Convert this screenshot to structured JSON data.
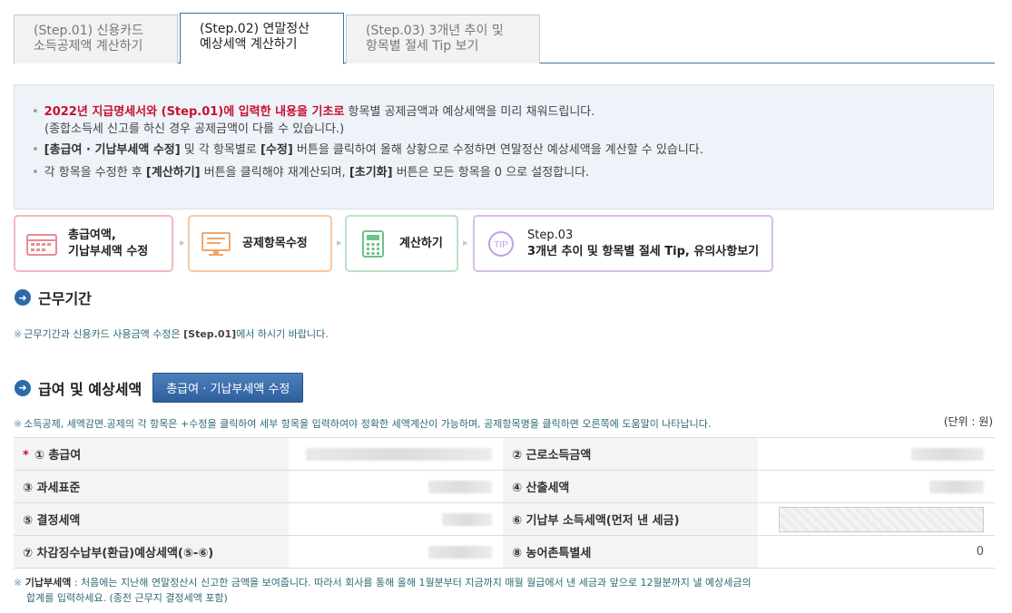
{
  "tabs": [
    {
      "line1": "(Step.01) 신용카드",
      "line2": "소득공제액 계산하기"
    },
    {
      "line1": "(Step.02) 연말정산",
      "line2": "예상세액 계산하기"
    },
    {
      "line1": "(Step.03) 3개년 추이 및",
      "line2": "항목별 절세 Tip 보기"
    }
  ],
  "info": {
    "line1_red": "2022년 지급명세서와 (Step.01)에 입력한 내용을 기초로",
    "line1_rest": " 항목별 공제금액과 예상세액을 미리 채워드립니다.",
    "line1_sub": "(종합소득세 신고를 하신 경우 공제금액이 다를 수 있습니다.)",
    "line2_bold1": "[총급여 · 기납부세액 수정]",
    "line2_mid": " 및 각 항목별로 ",
    "line2_bold2": "[수정]",
    "line2_rest": " 버튼을 클릭하여 올해 상황으로 수정하면 연말정산 예상세액을 계산할 수 있습니다.",
    "line3_a": "각 항목을 수정한 후 ",
    "line3_bold1": "[계산하기]",
    "line3_b": " 버튼을 클릭해야 재계산되며, ",
    "line3_bold2": "[초기화]",
    "line3_c": " 버튼은 모든 항목을 0 으로 설정합니다."
  },
  "steps": [
    {
      "line1": "총급여액,",
      "line2": "기납부세액 수정",
      "color": "#f2b8be"
    },
    {
      "line1": "공제항목수정",
      "line2": "",
      "color": "#f7c8a3"
    },
    {
      "line1": "계산하기",
      "line2": "",
      "color": "#b8e3c6"
    },
    {
      "line1": "Step.03",
      "line2": "3개년 추이 및 항목별 절세 Tip, 유의사항보기",
      "color": "#d6bde9"
    }
  ],
  "section1": {
    "title": "근무기간"
  },
  "note1": {
    "before": "근무기간과 신용카드 사용금액 수정은 ",
    "bold": "[Step.01]",
    "after": "에서 하시기 바랍니다."
  },
  "section2": {
    "title": "급여 및 예상세액",
    "button": "총급여 · 기납부세액 수정"
  },
  "note2": "소득공제, 세액감면.공제의 각 항목은 +수정을 클릭하여 세부 항목을 입력하여야 정확한 세액계산이 가능하며, 공제항목명을 클릭하면 오른쪽에 도움말이 나타납니다.",
  "unit": "(단위 : 원)",
  "table": {
    "rows": [
      {
        "l1": "① 총급여",
        "l2": "② 근로소득금액",
        "v2": ""
      },
      {
        "l1": "③ 과세표준",
        "l2": "④ 산출세액",
        "v2": ""
      },
      {
        "l1": "⑤ 결정세액",
        "l2": "⑥ 기납부 소득세액(먼저 낸 세금)",
        "v2": ""
      },
      {
        "l1": "⑦ 차감징수납부(환급)예상세액(⑤-⑥)",
        "l2": "⑧ 농어촌특별세",
        "v2": "0"
      }
    ]
  },
  "foot": {
    "bold": "기납부세액",
    "line1": " : 처음에는 지난해 연말정산시 신고한 금액을 보여줍니다. 따라서 회사를 통해 올해 1월분부터 지금까지 매월 월급에서 낸 세금과 앞으로 12월분까지 낼 예상세금의",
    "line2": "합계를 입력하세요. (종전 근무지 결정세액 포함)"
  }
}
